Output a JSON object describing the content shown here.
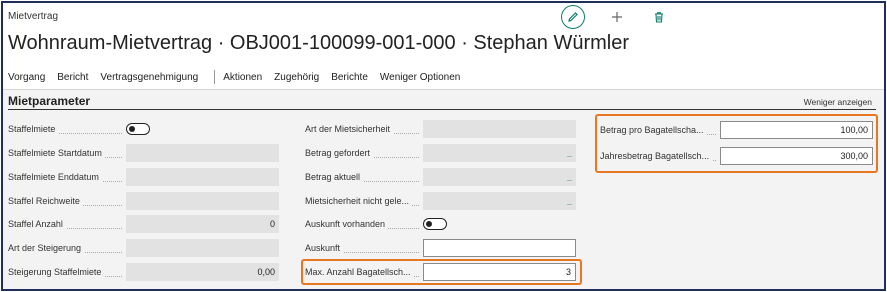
{
  "header": {
    "breadcrumb": "Mietvertrag",
    "title": "Wohnraum-Mietvertrag · OBJ001-100099-001-000 · Stephan Würmler"
  },
  "icons": {
    "edit": "pencil-icon",
    "new": "plus-icon",
    "delete": "trash-icon"
  },
  "menu": {
    "items": [
      "Vorgang",
      "Bericht",
      "Vertragsgenehmigung",
      "Aktionen",
      "Zugehörig",
      "Berichte",
      "Weniger Optionen"
    ]
  },
  "section": {
    "title": "Mietparameter",
    "toggle_label": "Weniger anzeigen"
  },
  "col1": [
    {
      "label": "Staffelmiete",
      "type": "toggle",
      "value": ""
    },
    {
      "label": "Staffelmiete Startdatum",
      "type": "readonly",
      "value": ""
    },
    {
      "label": "Staffelmiete Enddatum",
      "type": "readonly",
      "value": ""
    },
    {
      "label": "Staffel Reichweite",
      "type": "readonly",
      "value": ""
    },
    {
      "label": "Staffel Anzahl",
      "type": "readonly",
      "value": "0"
    },
    {
      "label": "Art der Steigerung",
      "type": "readonly",
      "value": ""
    },
    {
      "label": "Steigerung Staffelmiete",
      "type": "readonly",
      "value": "0,00"
    }
  ],
  "col2": [
    {
      "label": "Art der Mietsicherheit",
      "type": "readonly",
      "value": ""
    },
    {
      "label": "Betrag gefordert",
      "type": "readonly",
      "value": "_"
    },
    {
      "label": "Betrag aktuell",
      "type": "readonly",
      "value": "_"
    },
    {
      "label": "Mietsicherheit nicht gele...",
      "type": "readonly",
      "value": "_"
    },
    {
      "label": "Auskunft vorhanden",
      "type": "toggle",
      "value": ""
    },
    {
      "label": "Auskunft",
      "type": "edit",
      "value": ""
    },
    {
      "label": "Max. Anzahl Bagatellsch...",
      "type": "edit",
      "value": "3"
    }
  ],
  "col3": [
    {
      "label": "Betrag pro Bagatellscha...",
      "type": "edit",
      "value": "100,00"
    },
    {
      "label": "Jahresbetrag Bagatellsch...",
      "type": "edit",
      "value": "300,00"
    }
  ],
  "colors": {
    "accent": "#0f7b6c",
    "highlight": "#e87722",
    "frame": "#1f2f5c"
  }
}
